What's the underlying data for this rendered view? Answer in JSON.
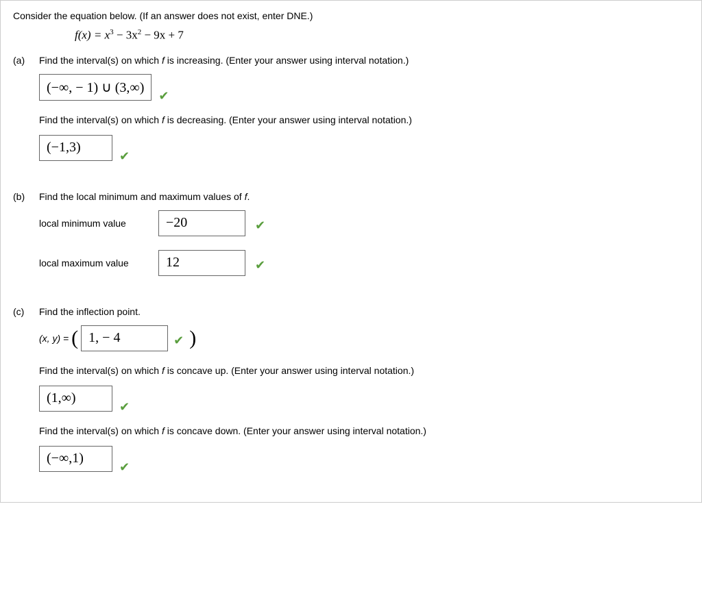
{
  "intro": "Consider the equation below. (If an answer does not exist, enter DNE.)",
  "equation_prefix": "f(x) = x",
  "equation_rest_1": " − 3x",
  "equation_rest_2": " − 9x + 7",
  "parts": {
    "a": {
      "label": "(a)",
      "q1": "Find the interval(s) on which ",
      "q1_fi": "f",
      "q1_end": " is increasing. (Enter your answer using interval notation.)",
      "ans1": "(−∞, − 1) ∪ (3,∞)",
      "q2": "Find the interval(s) on which ",
      "q2_fi": "f",
      "q2_end": " is decreasing. (Enter your answer using interval notation.)",
      "ans2": "(−1,3)"
    },
    "b": {
      "label": "(b)",
      "q": "Find the local minimum and maximum values of ",
      "q_fi": "f",
      "q_end": ".",
      "min_label": "local minimum value",
      "min_ans": "−20",
      "max_label": "local maximum value",
      "max_ans": "12"
    },
    "c": {
      "label": "(c)",
      "q": "Find the inflection point.",
      "xy_label": "(x, y) = ",
      "inflect_ans": "1, − 4",
      "q2": "Find the interval(s) on which ",
      "q2_fi": "f",
      "q2_end": " is concave up. (Enter your answer using interval notation.)",
      "ans2": "(1,∞)",
      "q3": "Find the interval(s) on which ",
      "q3_fi": "f",
      "q3_end": " is concave down. (Enter your answer using interval notation.)",
      "ans3": "(−∞,1)"
    }
  }
}
